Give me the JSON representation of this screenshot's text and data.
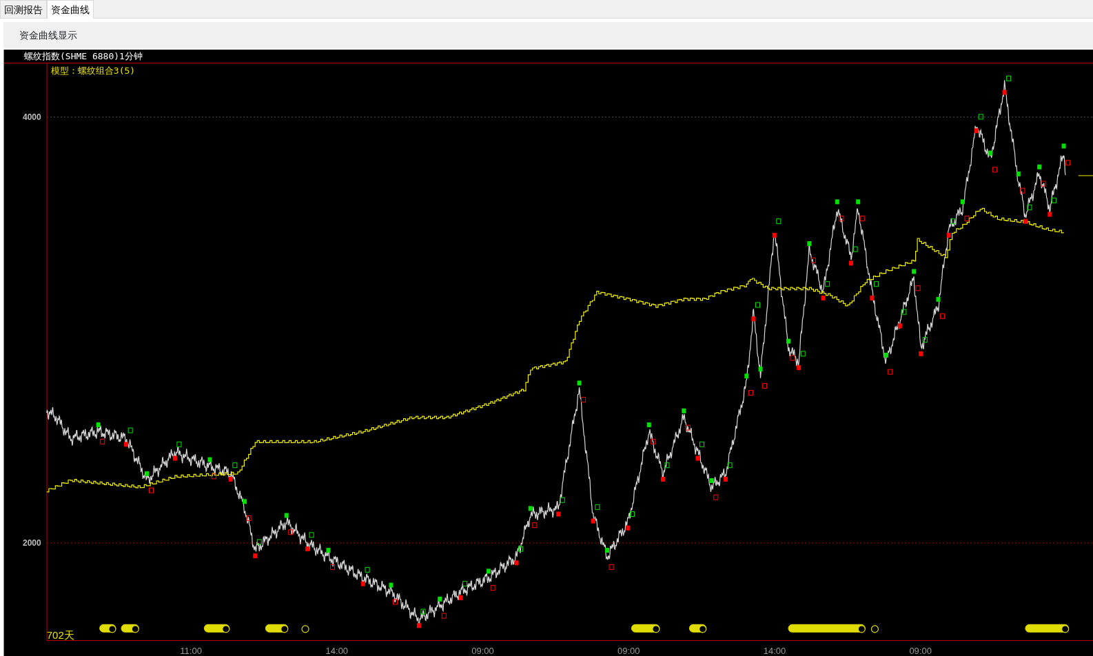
{
  "tabs": [
    {
      "label": "回测报告",
      "selected": false
    },
    {
      "label": "资金曲线",
      "selected": true
    }
  ],
  "toolbar": {
    "title": "资金曲线显示"
  },
  "chart": {
    "title": "螺纹指数(SHME 6880)1分钟",
    "model_label": "模型：螺纹组合3(5)",
    "y_labels": [
      "4000",
      "2000"
    ],
    "x_labels": [
      "11:00",
      "14:00",
      "09:00",
      "09:00",
      "14:00",
      "09:00"
    ],
    "days_label": "702天"
  }
}
